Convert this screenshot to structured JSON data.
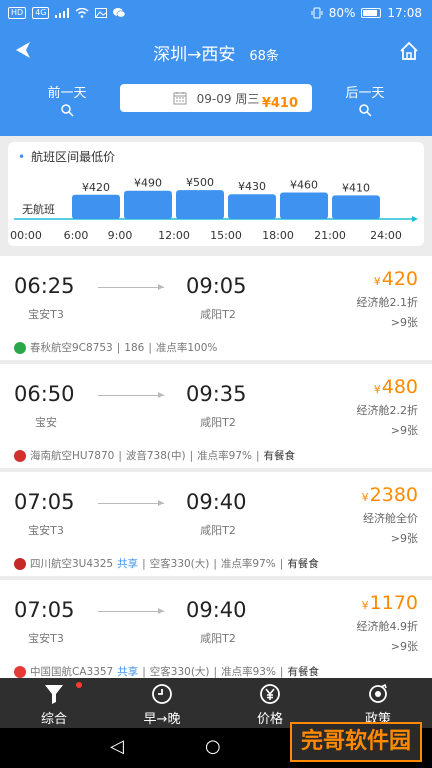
{
  "status_bar": {
    "left_chips": [
      "HD",
      "4G"
    ],
    "battery": "80%",
    "time": "17:08"
  },
  "header": {
    "title": "深圳→西安",
    "count": "68条",
    "prev_day": "前一天",
    "next_day": "后一天",
    "date": "09-09 周三",
    "date_price": "¥410",
    "back_icon": "back-arrow-icon",
    "home_icon": "home-icon"
  },
  "chart_data": {
    "type": "bar",
    "title": "航班区间最低价",
    "no_flight_label": "无航班",
    "x_tick_labels": [
      "00:00",
      "6:00",
      "9:00",
      "12:00",
      "15:00",
      "18:00",
      "21:00",
      "24:00"
    ],
    "categories": [
      "6:00-9:00",
      "9:00-12:00",
      "12:00-15:00",
      "15:00-18:00",
      "18:00-21:00",
      "21:00-24:00"
    ],
    "values": [
      420,
      490,
      500,
      430,
      460,
      410
    ],
    "value_labels": [
      "¥420",
      "¥490",
      "¥500",
      "¥430",
      "¥460",
      "¥410"
    ],
    "bar_color": "#3f93f0"
  },
  "flights": [
    {
      "dep_time": "06:25",
      "dep_airport": "宝安T3",
      "arr_time": "09:05",
      "arr_airport": "咸阳T2",
      "yen": "¥",
      "price": "420",
      "cabin": "经济舱2.1折",
      "seats": ">9张",
      "airline": "春秋航空9C8753",
      "share": "",
      "aircraft": "186",
      "punctuality": "准点率100%",
      "meal": "",
      "logo_color": "#2aa74a"
    },
    {
      "dep_time": "06:50",
      "dep_airport": "宝安",
      "arr_time": "09:35",
      "arr_airport": "咸阳T2",
      "yen": "¥",
      "price": "480",
      "cabin": "经济舱2.2折",
      "seats": ">9张",
      "airline": "海南航空HU7870",
      "share": "",
      "aircraft": "波音738(中)",
      "punctuality": "准点率97%",
      "meal": "有餐食",
      "logo_color": "#d32f2f"
    },
    {
      "dep_time": "07:05",
      "dep_airport": "宝安T3",
      "arr_time": "09:40",
      "arr_airport": "咸阳T2",
      "yen": "¥",
      "price": "2380",
      "cabin": "经济舱全价",
      "seats": ">9张",
      "airline": "四川航空3U4325",
      "share": "共享",
      "aircraft": "空客330(大)",
      "punctuality": "准点率97%",
      "meal": "有餐食",
      "logo_color": "#c62828"
    },
    {
      "dep_time": "07:05",
      "dep_airport": "宝安T3",
      "arr_time": "09:40",
      "arr_airport": "咸阳T2",
      "yen": "¥",
      "price": "1170",
      "cabin": "经济舱4.9折",
      "seats": ">9张",
      "airline": "中国国航CA3357",
      "share": "共享",
      "aircraft": "空客330(大)",
      "punctuality": "准点率93%",
      "meal": "有餐食",
      "logo_color": "#e53935"
    }
  ],
  "bottom_nav": [
    {
      "label": "综合",
      "icon": "filter-icon"
    },
    {
      "label": "早→晚",
      "icon": "clock-icon"
    },
    {
      "label": "价格",
      "icon": "yen-icon"
    },
    {
      "label": "政策",
      "icon": "policy-icon"
    }
  ],
  "watermark": "完哥软件园",
  "colors": {
    "primary": "#3f93f0",
    "accent": "#ff8a00"
  }
}
